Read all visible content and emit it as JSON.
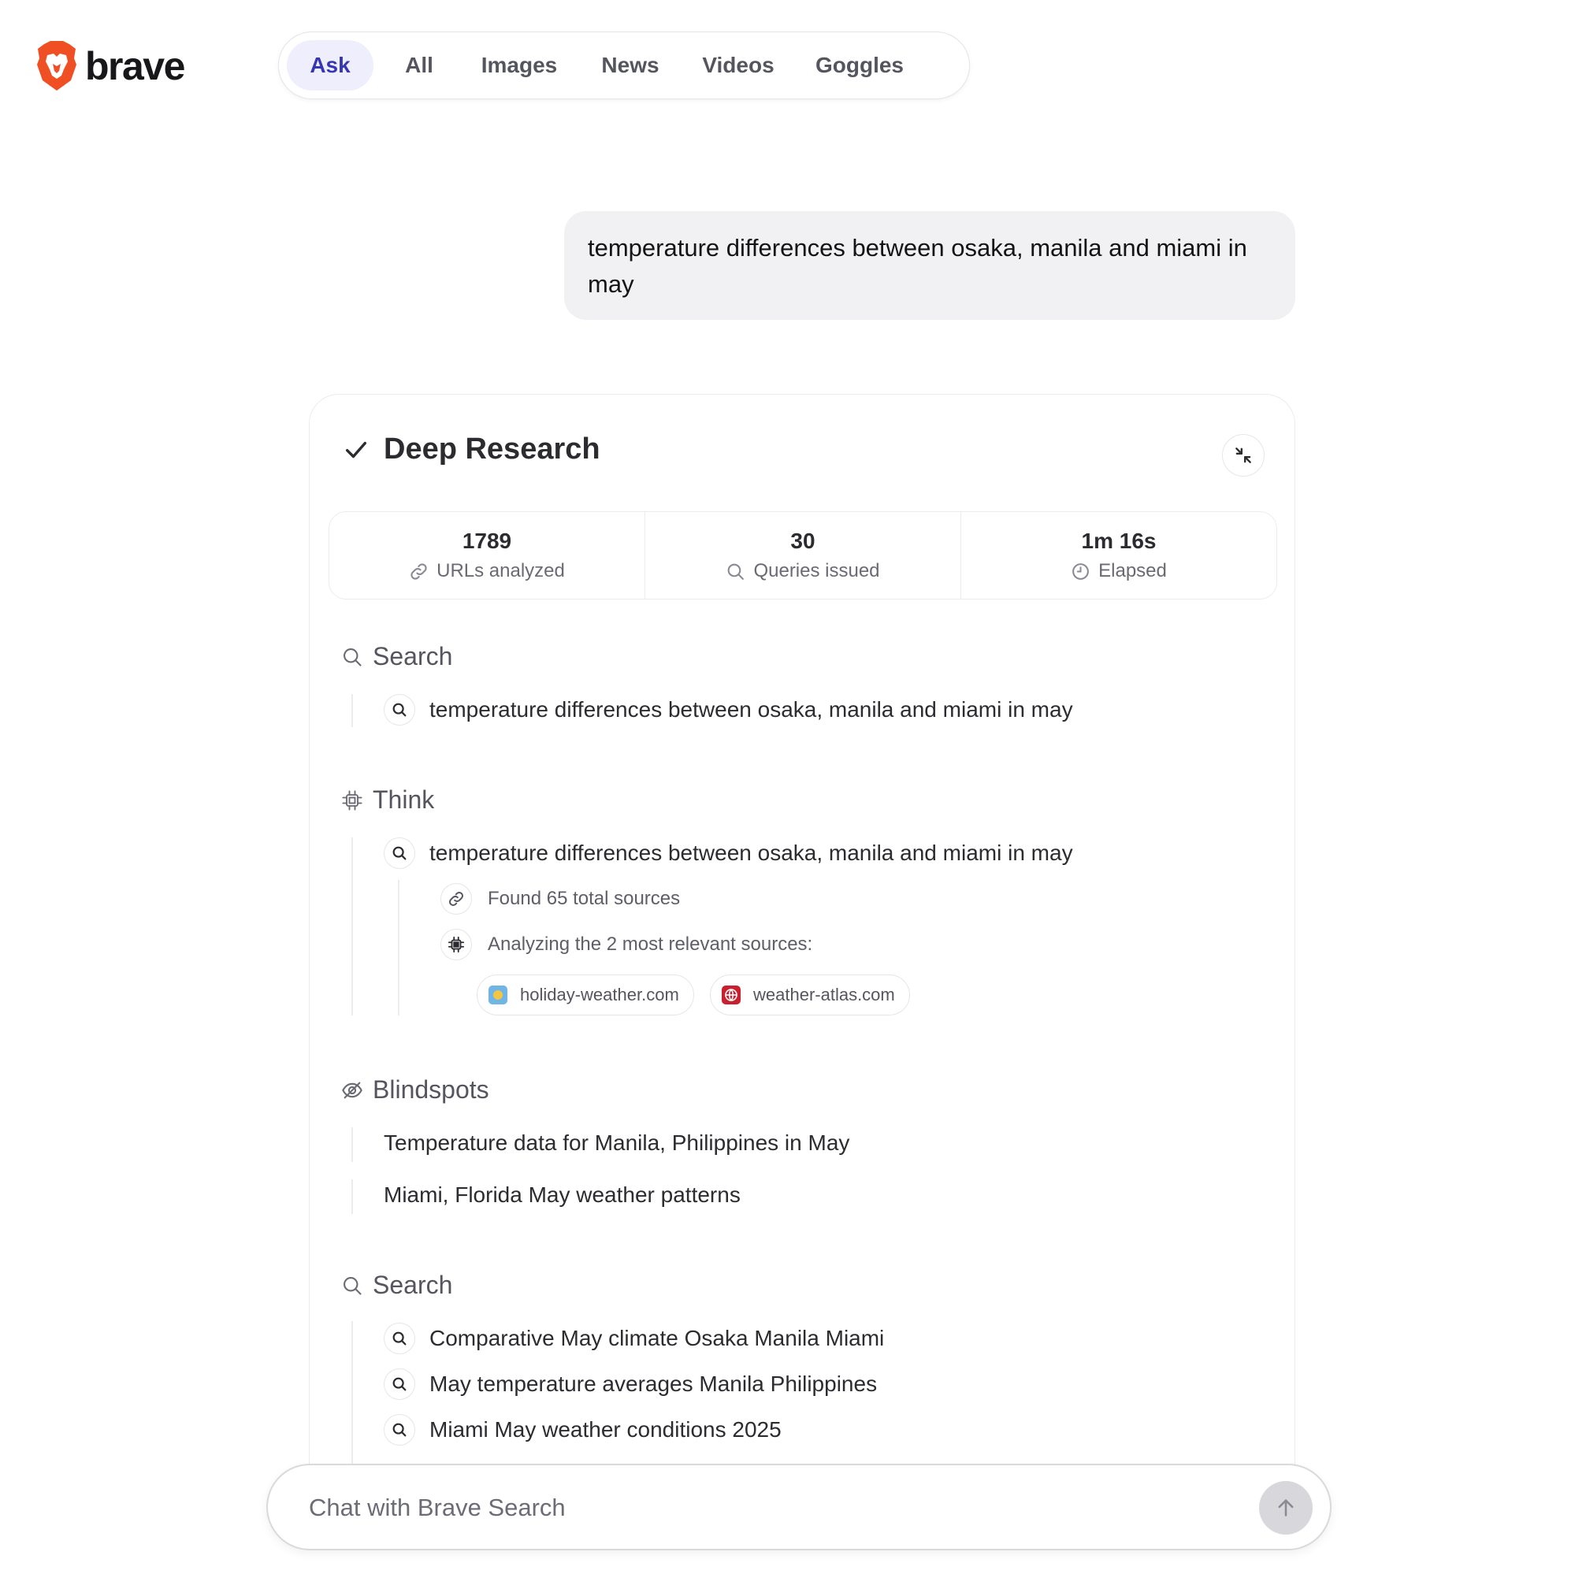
{
  "brand": {
    "name": "brave",
    "logo_color": "#f04e23"
  },
  "nav": {
    "tabs": [
      {
        "label": "Ask",
        "active": true
      },
      {
        "label": "All"
      },
      {
        "label": "Images"
      },
      {
        "label": "News"
      },
      {
        "label": "Videos"
      },
      {
        "label": "Goggles"
      }
    ]
  },
  "user_query": "temperature differences between osaka, manila and miami in may",
  "research": {
    "title": "Deep Research",
    "status_icon": "check-icon",
    "collapse_icon": "minimize-icon",
    "stats": [
      {
        "value": "1789",
        "label": "URLs analyzed",
        "icon": "link-icon"
      },
      {
        "value": "30",
        "label": "Queries issued",
        "icon": "search-icon"
      },
      {
        "value": "1m 16s",
        "label": "Elapsed",
        "icon": "clock-icon"
      }
    ],
    "search1": {
      "title": "Search",
      "queries": [
        "temperature differences between osaka, manila and miami in may"
      ]
    },
    "think": {
      "title": "Think",
      "query": "temperature differences between osaka, manila and miami in may",
      "found_sources": "Found 65 total sources",
      "analyzing": "Analyzing the 2 most relevant sources:",
      "sources": [
        {
          "domain": "holiday-weather.com",
          "favicon_color": "#6fb5e6"
        },
        {
          "domain": "weather-atlas.com",
          "favicon_color": "#c8202f"
        }
      ]
    },
    "blindspots": {
      "title": "Blindspots",
      "items": [
        "Temperature data for Manila, Philippines in May",
        "Miami, Florida May weather patterns"
      ]
    },
    "search2": {
      "title": "Search",
      "queries": [
        "Comparative May climate Osaka Manila Miami",
        "May temperature averages Manila Philippines",
        "Miami May weather conditions 2025"
      ]
    }
  },
  "chat": {
    "placeholder": "Chat with Brave Search",
    "value": ""
  }
}
